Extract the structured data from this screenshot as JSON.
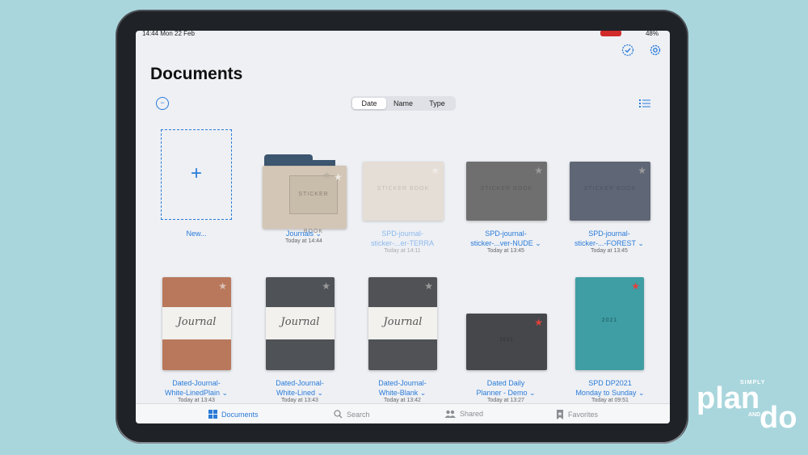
{
  "status": {
    "time": "14:44 Mon 22 Feb",
    "battery": "48%"
  },
  "header": {
    "title": "Documents"
  },
  "sort": {
    "options": [
      "Date",
      "Name",
      "Type"
    ],
    "selected": "Date"
  },
  "icons": {
    "select": "checkmark-circle-icon",
    "settings": "gear-icon",
    "collapse": "minus-circle-icon",
    "view": "list-view-icon"
  },
  "new_tile": {
    "label": "New..."
  },
  "row1": [
    {
      "title": "Journals",
      "date": "Today at 14:44",
      "type": "folder"
    },
    {
      "title1": "SPD-journal-",
      "title2": "sticker-...er-TERRA",
      "date": "Today at 14:11",
      "color": "#ddd3c7"
    },
    {
      "title1": "SPD-journal-",
      "title2": "sticker-...ver-NUDE",
      "date": "Today at 13:45",
      "color": "#6f6f70"
    },
    {
      "title1": "SPD-journal-",
      "title2": "sticker-...-FOREST",
      "date": "Today at 13:45",
      "color": "#5f6675"
    }
  ],
  "row2": [
    {
      "title1": "Dated-Journal-",
      "title2": "White-LinedPlain",
      "date": "Today at 13:43",
      "color": "#b9785c",
      "word": "Journal"
    },
    {
      "title1": "Dated-Journal-",
      "title2": "White-Lined",
      "date": "Today at 13:43",
      "color": "#4f5256",
      "word": "Journal"
    },
    {
      "title1": "Dated-Journal-",
      "title2": "White-Blank",
      "date": "Today at 13:42",
      "color": "#505255",
      "word": "Journal"
    },
    {
      "title1": "Dated Daily",
      "title2": "Planner - Demo",
      "date": "Today at 13:27",
      "color": "#45474b",
      "word": "2021"
    },
    {
      "title1": "SPD DP2021",
      "title2": "Monday to Sunday",
      "date": "Today at 09:51",
      "color": "#3e9ea4",
      "word": "2021"
    }
  ],
  "sticker_text": "STICKER BOOK",
  "tabs": [
    {
      "label": "Documents",
      "icon": "grid-icon"
    },
    {
      "label": "Search",
      "icon": "search-icon"
    },
    {
      "label": "Shared",
      "icon": "people-icon"
    },
    {
      "label": "Favorites",
      "icon": "bookmark-star-icon"
    }
  ],
  "brand": {
    "simply": "SIMPLY",
    "plan": "plan",
    "and": "AND",
    "do": "do"
  },
  "colors": {
    "accent": "#2a7bd8",
    "star_grey": "#9a9a9a",
    "star_red": "#e0423b"
  }
}
